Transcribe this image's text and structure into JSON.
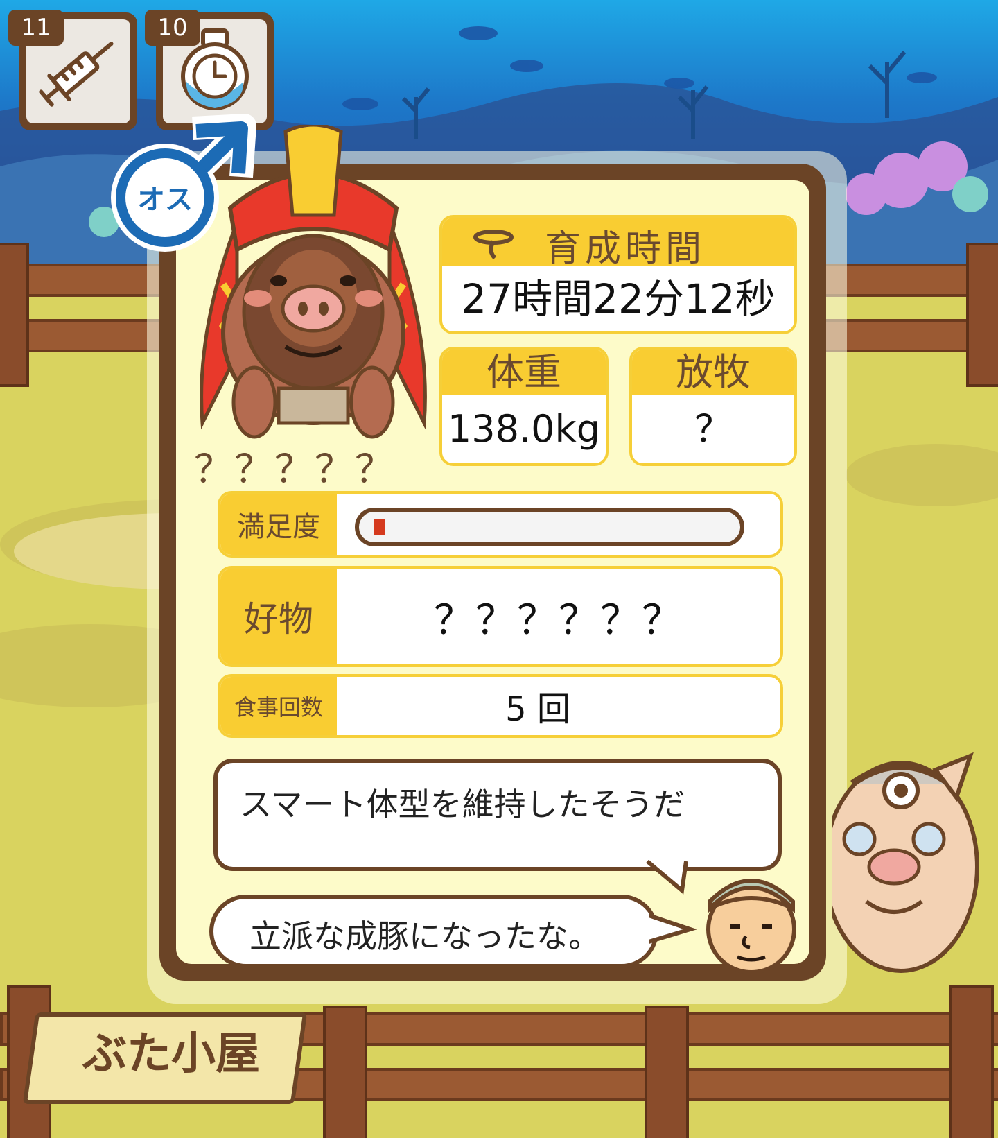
{
  "items": [
    {
      "count": "11",
      "icon": "syringe-icon"
    },
    {
      "count": "10",
      "icon": "stopwatch-potion-icon"
    }
  ],
  "gender": {
    "label": "オス",
    "icon": "male-symbol-icon"
  },
  "pig": {
    "name": "？？？？？"
  },
  "stats": {
    "raise_time_label": "育成時間",
    "raise_time_value": "27時間22分12秒",
    "weight_label": "体重",
    "weight_value": "138.0kg",
    "grazing_label": "放牧",
    "grazing_value": "？",
    "satisfaction_label": "満足度",
    "satisfaction_level": 0.03,
    "favorite_label": "好物",
    "favorite_value": "？？？？？？",
    "meals_label": "食事回数",
    "meals_value": "5 回"
  },
  "messages": {
    "info": "スマート体型を維持したそうだ",
    "farmer": "立派な成豚になったな。"
  },
  "sign": {
    "text": "ぶた小屋"
  },
  "colors": {
    "accent": "#f9cd32",
    "frame": "#6b4426",
    "panel": "#fdfbc9",
    "bar": "#d53a1e"
  }
}
